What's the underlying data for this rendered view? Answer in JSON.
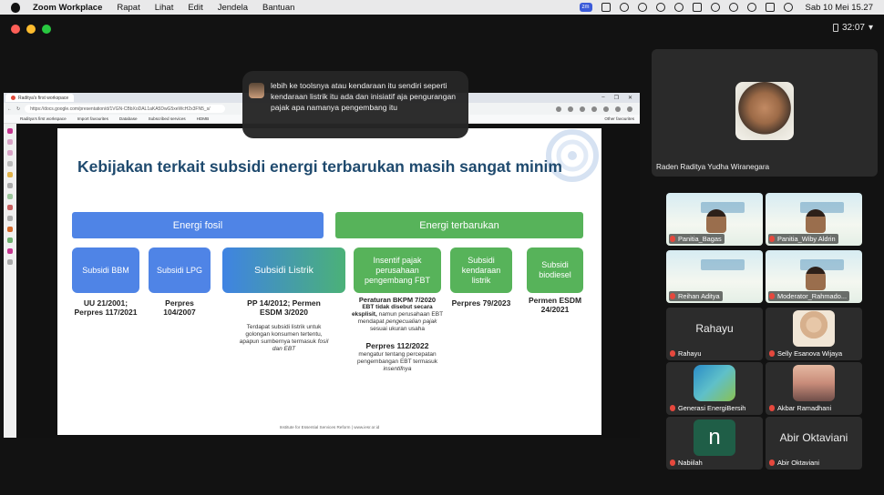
{
  "menubar": {
    "app": "Zoom Workplace",
    "items": [
      "Rapat",
      "Lihat",
      "Edit",
      "Jendela",
      "Bantuan"
    ],
    "clock": "Sab 10 Mei  15.27"
  },
  "meeting": {
    "timer": "32:07"
  },
  "browser": {
    "tab_title": "Raditya's first workspace",
    "url": "https://docs.google.com/presentation/d/1VGN-CBbXoDAL1aKA5DwG5xeWcH2x3FN5_s/",
    "bookmarks": [
      "Raditya's first workspace",
      "Import favourites",
      "Database",
      "Subscribed services",
      "HDMB"
    ],
    "other_bookmarks": "Other favourites"
  },
  "slide": {
    "title": "Kebijakan terkait subsidi energi terbarukan masih sangat minim",
    "bar_fossil": "Energi fosil",
    "bar_renewable": "Energi terbarukan",
    "boxes": {
      "bbm": "Subsidi BBM",
      "lpg": "Subsidi LPG",
      "listrik": "Subsidi Listrik",
      "insentif": "Insentif pajak perusahaan pengembang FBT",
      "kendaraan": "Subsidi kendaraan listrik",
      "biodiesel": "Subsidi biodiesel"
    },
    "refs": {
      "bbm": "UU 21/2001; Perpres 117/2021",
      "lpg": "Perpres 104/2007",
      "listrik": "PP 14/2012; Permen ESDM 3/2020",
      "insentif": "Peraturan BKPM 7/2020",
      "kendaraan": "Perpres 79/2023",
      "biodiesel": "Permen ESDM 24/2021"
    },
    "notes": {
      "listrik_1": "Terdapat subsidi listrik untuk golongan konsumen tertentu, apapun sumbernya termasuk",
      "listrik_2": "fosil dan EBT",
      "insentif_bold": "EBT tidak disebut secara eksplisit,",
      "insentif_1": "namun perusahaan EBT mendapat",
      "insentif_italic1": "pengecualian pajak",
      "insentif_2": "sesuai ukuran usaha",
      "perpres_title": "Perpres 112/2022",
      "perpres_1": "mengatur tentang percepatan pengembangan EBT termasuk",
      "perpres_italic": "insentifnya"
    },
    "footer": "Institute for Essential Services Reform | www.iesr.or.id"
  },
  "chat": {
    "message": "lebih ke toolsnya atau kendaraan itu sendiri seperti kendaraan listrik itu ada dan inisiatif aja pengurangan pajak apa namanya pengembang itu"
  },
  "speaker": {
    "name": "Raden Raditya Yudha Wiranegara"
  },
  "participants": [
    {
      "name": "Panitia_Bagas"
    },
    {
      "name": "Panitia_Wiby Aldrin"
    },
    {
      "name": "Reihan Aditya"
    },
    {
      "name": "Moderator_Rahmado..."
    },
    {
      "name": "Rahayu",
      "display": "Rahayu"
    },
    {
      "name": "Selly Esanova Wijaya"
    },
    {
      "name": "Generasi EnergiBersih"
    },
    {
      "name": "Akbar Ramadhani"
    },
    {
      "name": "Nabiilah",
      "initial": "n"
    },
    {
      "name": "Abir Oktaviani",
      "display": "Abir Oktaviani"
    }
  ],
  "colors": {
    "fossil_blue": "#4f84e6",
    "renewable_green": "#57b35a",
    "title_navy": "#1f4a6e",
    "mic_muted": "#e5483d"
  }
}
